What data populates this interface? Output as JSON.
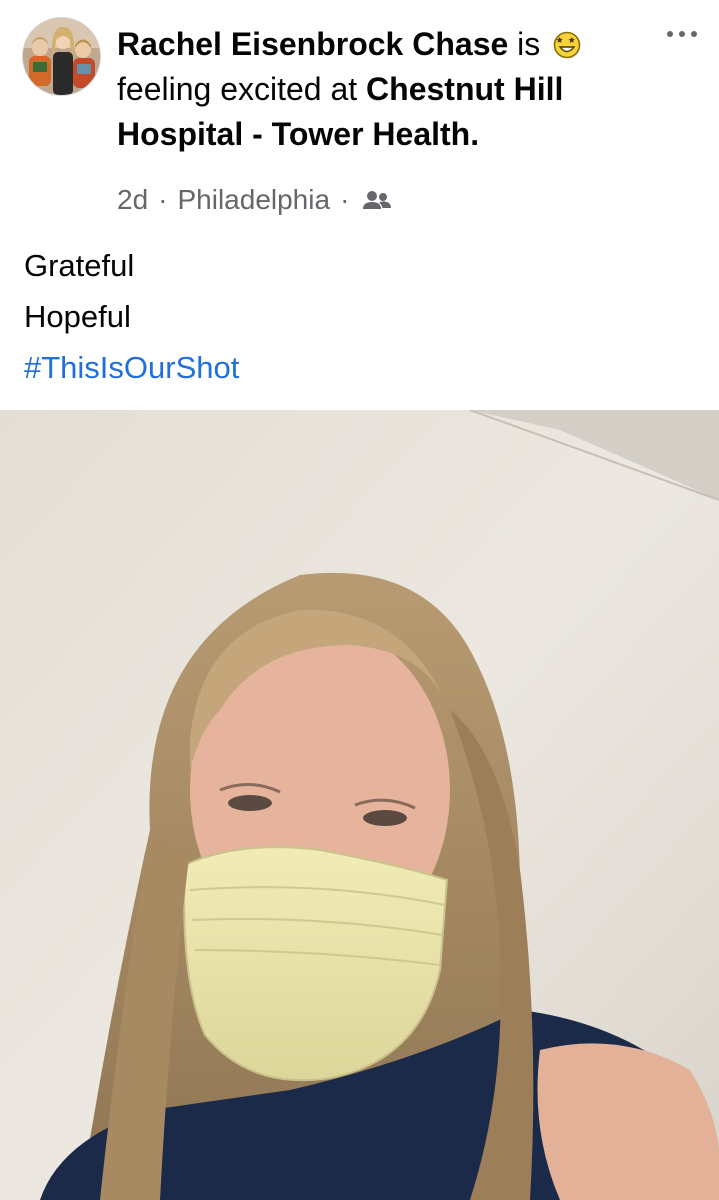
{
  "post": {
    "author": "Rachel Eisenbrock Chase",
    "feeling_prefix": "is",
    "feeling_text": "feeling excited at",
    "location_name": "Chestnut Hill Hospital - Tower Health.",
    "time": "2d",
    "place": "Philadelphia",
    "separator": "·",
    "audience_icon": "friends-icon",
    "feeling_icon": "excited-emoji-icon",
    "more_icon": "more-options-icon",
    "body_lines": [
      "Grateful",
      "Hopeful"
    ],
    "hashtag": "#ThisIsOurShot"
  },
  "colors": {
    "text": "#050505",
    "secondary": "#65676b",
    "link": "#216fdb",
    "background": "#ffffff"
  }
}
